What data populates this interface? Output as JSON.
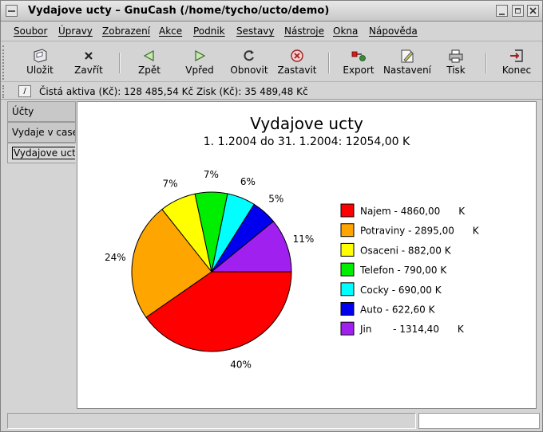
{
  "window": {
    "title": "Vydajove ucty  –  GnuCash (/home/tycho/ucto/demo)"
  },
  "menu": [
    {
      "label": "Soubor"
    },
    {
      "label": "Úpravy"
    },
    {
      "label": "Zobrazení"
    },
    {
      "label": "Akce"
    },
    {
      "label": "Podnik"
    },
    {
      "label": "Sestavy"
    },
    {
      "label": "Nástroje"
    },
    {
      "label": "Okna"
    },
    {
      "label": "Nápověda"
    }
  ],
  "toolbar": {
    "save": "Uložit",
    "close": "Zavřít",
    "back": "Zpět",
    "forward": "Vpřed",
    "reload": "Obnovit",
    "stop": "Zastavit",
    "export": "Export",
    "options": "Nastavení",
    "print": "Tisk",
    "quit": "Konec"
  },
  "summary": {
    "text": "Čistá aktiva (Kč): 128 485,54 Kč    Zisk (Kč): 35 489,48 Kč"
  },
  "tabs": [
    {
      "label": "Účty"
    },
    {
      "label": "Vydaje v case"
    },
    {
      "label": "Vydajove ucty"
    }
  ],
  "report": {
    "title": "Vydajove ucty",
    "subtitle": "1. 1.2004 do 31. 1.2004: 12054,00       K"
  },
  "chart_data": {
    "type": "pie",
    "title": "Vydajove ucty",
    "subtitle": "1. 1.2004 do 31. 1.2004: 12054,00       K",
    "legend_position": "right",
    "slices": [
      {
        "name": "Najem",
        "legend": "Najem - 4860,00      K",
        "value": 4860.0,
        "percent_label": "40%",
        "color": "#ff0000"
      },
      {
        "name": "Potraviny",
        "legend": "Potraviny - 2895,00      K",
        "value": 2895.0,
        "percent_label": "24%",
        "color": "#ffa500"
      },
      {
        "name": "Osaceni",
        "legend": "Osaceni - 882,00 K",
        "value": 882.0,
        "percent_label": "7%",
        "color": "#ffff00"
      },
      {
        "name": "Telefon",
        "legend": "Telefon - 790,00 K",
        "value": 790.0,
        "percent_label": "7%",
        "color": "#00ee00"
      },
      {
        "name": "Cocky",
        "legend": "Cocky - 690,00 K",
        "value": 690.0,
        "percent_label": "6%",
        "color": "#00ffff"
      },
      {
        "name": "Auto",
        "legend": "Auto - 622,60 K",
        "value": 622.6,
        "percent_label": "5%",
        "color": "#0000ee"
      },
      {
        "name": "Jin",
        "legend": "Jin       - 1314,40      K",
        "value": 1314.4,
        "percent_label": "11%",
        "color": "#a020f0"
      }
    ]
  }
}
